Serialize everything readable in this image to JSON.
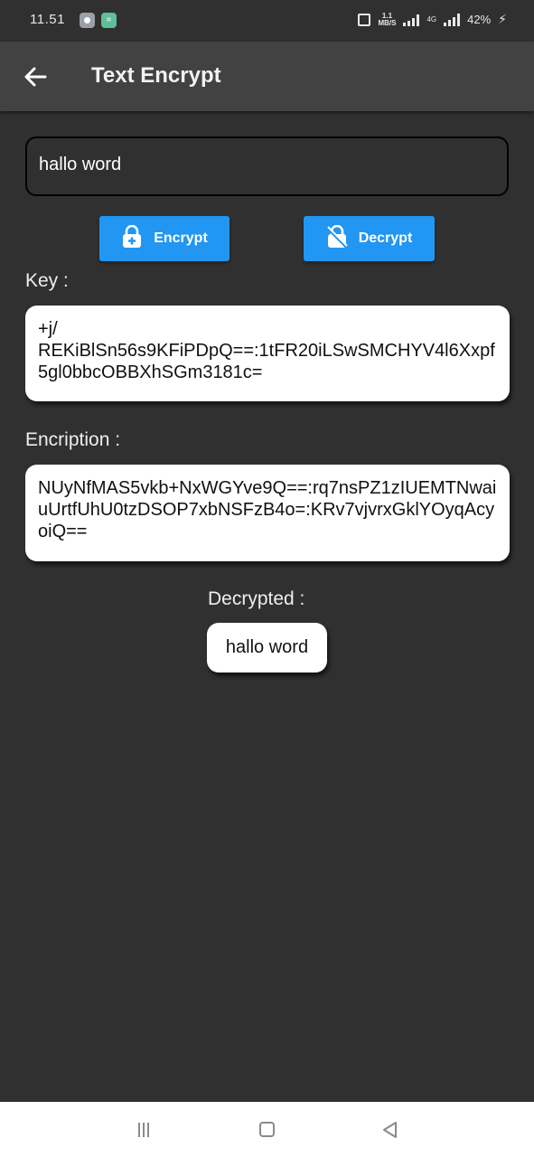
{
  "status_bar": {
    "time": "11.51",
    "speed_top": "1.1",
    "speed_unit": "MB/S",
    "network": "4G",
    "battery": "42%"
  },
  "app_bar": {
    "title": "Text Encrypt",
    "back_icon": "arrow-left-icon"
  },
  "input": {
    "value": "hallo word"
  },
  "buttons": {
    "encrypt_label": "Encrypt",
    "encrypt_icon": "lock-plus-icon",
    "decrypt_label": "Decrypt",
    "decrypt_icon": "lock-open-slash-icon",
    "color": "#2196f3"
  },
  "key": {
    "label": "Key :",
    "value": "+j/\nREKiBlSn56s9KFiPDpQ==:1tFR20iLSwSMCHYV4l6Xxpf5gl0bbcOBBXhSGm3181c="
  },
  "encryption": {
    "label": "Encription :",
    "value": "NUyNfMAS5vkb+NxWGYve9Q==:rq7nsPZ1zIUEMTNwaiuUrtfUhU0tzDSOP7xbNSFzB4o=:KRv7vjvrxGklYOyqAcyoiQ=="
  },
  "decrypted": {
    "label": "Decrypted :",
    "value": "hallo word"
  },
  "nav_bar": {
    "menu_icon": "recent-apps-icon",
    "home_icon": "home-square-icon",
    "back_icon": "back-triangle-icon"
  }
}
